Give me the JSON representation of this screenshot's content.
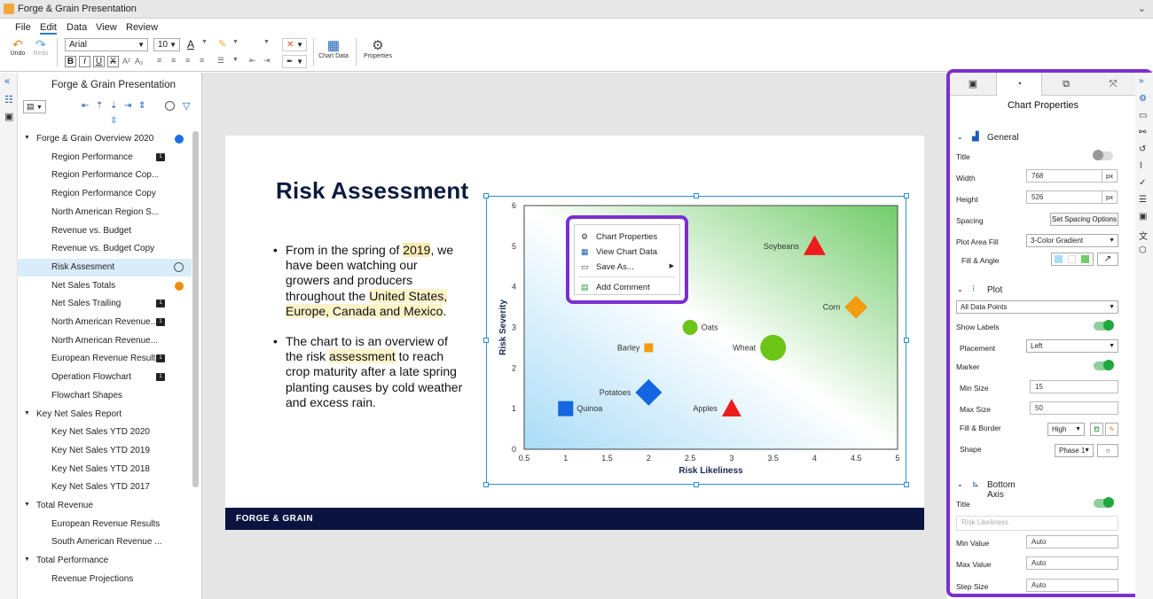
{
  "app": {
    "title": "Forge & Grain Presentation"
  },
  "menu": [
    "File",
    "Edit",
    "Data",
    "View",
    "Review"
  ],
  "ribbon": {
    "undo": "Undo",
    "redo": "Redo",
    "font": "Arial",
    "size": "10",
    "chart_data": "Chart Data",
    "properties": "Properties"
  },
  "outline": {
    "title": "Forge & Grain Presentation",
    "items": [
      {
        "label": "Forge & Grain Overview 2020",
        "type": "group"
      },
      {
        "label": "Region Performance",
        "type": "child"
      },
      {
        "label": "Region Performance Cop...",
        "type": "child"
      },
      {
        "label": "Region Performance Copy",
        "type": "child"
      },
      {
        "label": "North American Region S...",
        "type": "child"
      },
      {
        "label": "Revenue vs. Budget",
        "type": "child"
      },
      {
        "label": "Revenue vs. Budget Copy",
        "type": "child"
      },
      {
        "label": "Risk Assesment",
        "type": "child"
      },
      {
        "label": "Net Sales Totals",
        "type": "child"
      },
      {
        "label": "Net Sales Trailing",
        "type": "child"
      },
      {
        "label": "North American Revenue...",
        "type": "child"
      },
      {
        "label": "North American Revenue...",
        "type": "child"
      },
      {
        "label": "European Revenue Results",
        "type": "child"
      },
      {
        "label": "Operation Flowchart",
        "type": "child"
      },
      {
        "label": "Flowchart Shapes",
        "type": "child"
      },
      {
        "label": "Key Net Sales Report",
        "type": "group"
      },
      {
        "label": "Key Net Sales YTD 2020",
        "type": "child"
      },
      {
        "label": "Key Net Sales YTD 2019",
        "type": "child"
      },
      {
        "label": "Key Net Sales YTD 2018",
        "type": "child"
      },
      {
        "label": "Key Net Sales YTD 2017",
        "type": "child"
      },
      {
        "label": "Total Revenue",
        "type": "group"
      },
      {
        "label": "European Revenue Results",
        "type": "child"
      },
      {
        "label": "South American Revenue ...",
        "type": "child"
      },
      {
        "label": "Total Performance",
        "type": "group"
      },
      {
        "label": "Revenue Projections",
        "type": "child"
      }
    ]
  },
  "slide": {
    "title": "Risk Assessment",
    "footer": "FORGE & GRAIN",
    "bullet1": {
      "a": "From in the spring of ",
      "h1": "2019",
      "b": ", we have been watching our growers and producers throughout the ",
      "h2": "United States, Europe, Canada and Mexico",
      "c": "."
    },
    "bullet2": {
      "a": "The chart to is an overview of the risk ",
      "h": "assessment",
      "b": " to reach crop maturity after a late spring planting causes by cold weather and excess rain."
    }
  },
  "chart_data": {
    "type": "scatter",
    "xlabel": "Risk Likeliness",
    "ylabel": "Risk Severity",
    "xlim": [
      0.5,
      5
    ],
    "ylim": [
      0,
      6
    ],
    "xticks": [
      "0.5",
      "1",
      "1.5",
      "2",
      "2.5",
      "3",
      "3.5",
      "4",
      "4.5",
      "5"
    ],
    "yticks": [
      "0",
      "1",
      "2",
      "3",
      "4",
      "5",
      "6"
    ],
    "points": [
      {
        "name": "Quinoa",
        "x": 1.0,
        "y": 1.0,
        "shape": "square",
        "color": "#1565e0",
        "size": 17
      },
      {
        "name": "Potatoes",
        "x": 2.0,
        "y": 1.4,
        "shape": "diamond",
        "color": "#1565e0",
        "size": 30
      },
      {
        "name": "Barley",
        "x": 2.0,
        "y": 2.5,
        "shape": "square",
        "color": "#f39c12",
        "size": 10
      },
      {
        "name": "Oats",
        "x": 2.5,
        "y": 3.0,
        "shape": "circle",
        "color": "#6cc417",
        "size": 17
      },
      {
        "name": "Apples",
        "x": 3.0,
        "y": 1.0,
        "shape": "triangle",
        "color": "#ee1c1c",
        "size": 22
      },
      {
        "name": "Wheat",
        "x": 3.5,
        "y": 2.5,
        "shape": "circle",
        "color": "#6cc417",
        "size": 29
      },
      {
        "name": "Soybeans",
        "x": 4.0,
        "y": 5.0,
        "shape": "triangle",
        "color": "#ee1c1c",
        "size": 25
      },
      {
        "name": "Corn",
        "x": 4.5,
        "y": 3.5,
        "shape": "diamond",
        "color": "#f39c12",
        "size": 26
      }
    ]
  },
  "context_menu": {
    "items": [
      "Chart Properties",
      "View Chart Data",
      "Save As...",
      "Add Comment"
    ]
  },
  "panel": {
    "title": "Chart Properties",
    "general": {
      "heading": "General",
      "title_label": "Title",
      "width_label": "Width",
      "width": "768",
      "unit": "px",
      "height_label": "Height",
      "height": "526",
      "spacing_label": "Spacing",
      "spacing_btn": "Set Spacing Options",
      "fill_label": "Plot Area Fill",
      "fill_value": "3-Color Gradient",
      "angle_label": "Fill & Angle"
    },
    "plot": {
      "heading": "Plot",
      "points": "All Data Points",
      "labels_label": "Show Labels",
      "placement_label": "Placement",
      "placement": "Left",
      "marker_label": "Marker",
      "min_label": "Min Size",
      "min": "15",
      "max_label": "Max Size",
      "max": "50",
      "border_label": "Fill & Border",
      "border_value": "High",
      "shape_label": "Shape",
      "shape_value": "Phase 1"
    },
    "axis": {
      "heading": "Bottom Axis",
      "title_label": "Title",
      "title_ph": "Risk Likeliness",
      "min_label": "Min Value",
      "min": "Auto",
      "max_label": "Max Value",
      "max": "Auto",
      "step_label": "Step Size",
      "step": "Auto"
    }
  },
  "colors": {
    "accent": "#7b2fd0",
    "selection": "#2b8fd6",
    "footer": "#0b1440"
  }
}
